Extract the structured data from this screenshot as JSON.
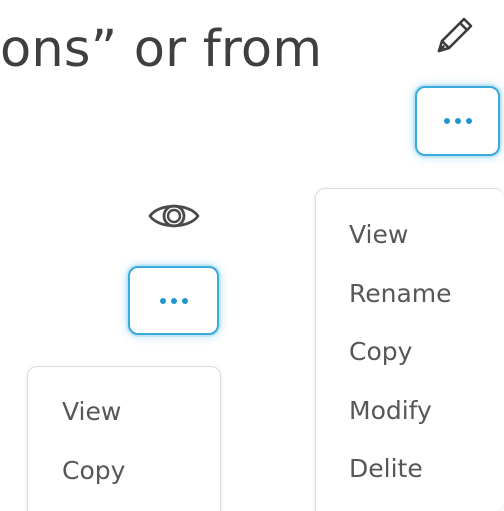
{
  "headline": {
    "text": "ons” or from"
  },
  "icons": {
    "pencil": "pencil-icon",
    "eye": "eye-icon",
    "more": "more-dots-icon"
  },
  "colors": {
    "accent": "#2396d0",
    "accent_border": "#3aa9db",
    "text_dark": "#3f3f3f",
    "menu_text": "#575757",
    "menu_border": "#d8dde3"
  },
  "pencil_menu": {
    "items": [
      {
        "label": "View"
      },
      {
        "label": "Rename"
      },
      {
        "label": "Copy"
      },
      {
        "label": "Modify"
      },
      {
        "label": "Delite"
      }
    ]
  },
  "eye_menu": {
    "items": [
      {
        "label": "View"
      },
      {
        "label": "Copy"
      }
    ]
  }
}
